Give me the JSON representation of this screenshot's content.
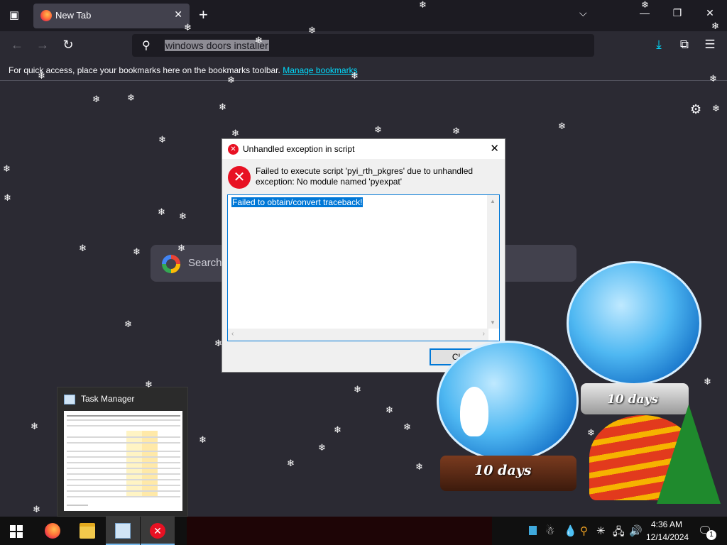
{
  "browser": {
    "tab": {
      "title": "New Tab"
    },
    "url_text": "windows doors installer",
    "bookmarks_bar": {
      "text": "For quick access, place your bookmarks here on the bookmarks toolbar.",
      "link": "Manage bookmarks"
    },
    "newtab_search": {
      "placeholder": "Search"
    },
    "accent_color": "#00ddff"
  },
  "dialog": {
    "title": "Unhandled exception in script",
    "message": "Failed to execute script 'pyi_rth_pkgres' due to unhandled exception: No module named 'pyexpat'",
    "traceback": "Failed to obtain/convert traceback!",
    "close_button": "Cl"
  },
  "task_manager_preview": {
    "title": "Task Manager"
  },
  "snow_globes": {
    "left_label": "10 days",
    "right_label": "10 days"
  },
  "taskbar": {
    "time": "4:36 AM",
    "date": "12/14/2024",
    "notification_count": "1"
  },
  "icons": {
    "tab_list": "tab-list-icon",
    "back": "back-arrow-icon",
    "forward": "forward-arrow-icon",
    "reload": "reload-icon",
    "download": "download-icon",
    "extensions": "extensions-icon",
    "menu": "hamburger-menu-icon",
    "settings": "gear-icon"
  }
}
